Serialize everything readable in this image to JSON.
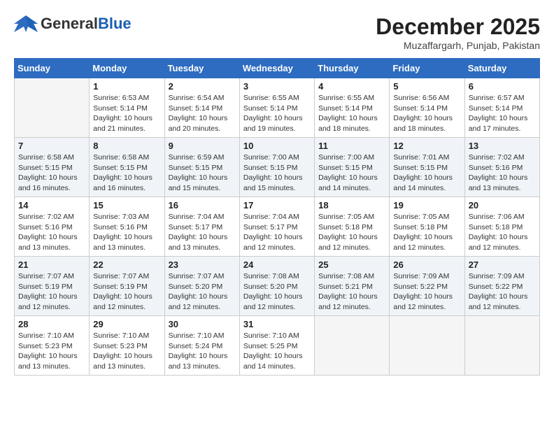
{
  "header": {
    "logo": {
      "general": "General",
      "blue": "Blue"
    },
    "title": "December 2025",
    "location": "Muzaffargarh, Punjab, Pakistan"
  },
  "weekdays": [
    "Sunday",
    "Monday",
    "Tuesday",
    "Wednesday",
    "Thursday",
    "Friday",
    "Saturday"
  ],
  "weeks": [
    {
      "shaded": false,
      "days": [
        {
          "num": "",
          "sunrise": "",
          "sunset": "",
          "daylight": "",
          "empty": true
        },
        {
          "num": "1",
          "sunrise": "Sunrise: 6:53 AM",
          "sunset": "Sunset: 5:14 PM",
          "daylight": "Daylight: 10 hours and 21 minutes.",
          "empty": false
        },
        {
          "num": "2",
          "sunrise": "Sunrise: 6:54 AM",
          "sunset": "Sunset: 5:14 PM",
          "daylight": "Daylight: 10 hours and 20 minutes.",
          "empty": false
        },
        {
          "num": "3",
          "sunrise": "Sunrise: 6:55 AM",
          "sunset": "Sunset: 5:14 PM",
          "daylight": "Daylight: 10 hours and 19 minutes.",
          "empty": false
        },
        {
          "num": "4",
          "sunrise": "Sunrise: 6:55 AM",
          "sunset": "Sunset: 5:14 PM",
          "daylight": "Daylight: 10 hours and 18 minutes.",
          "empty": false
        },
        {
          "num": "5",
          "sunrise": "Sunrise: 6:56 AM",
          "sunset": "Sunset: 5:14 PM",
          "daylight": "Daylight: 10 hours and 18 minutes.",
          "empty": false
        },
        {
          "num": "6",
          "sunrise": "Sunrise: 6:57 AM",
          "sunset": "Sunset: 5:14 PM",
          "daylight": "Daylight: 10 hours and 17 minutes.",
          "empty": false
        }
      ]
    },
    {
      "shaded": true,
      "days": [
        {
          "num": "7",
          "sunrise": "Sunrise: 6:58 AM",
          "sunset": "Sunset: 5:15 PM",
          "daylight": "Daylight: 10 hours and 16 minutes.",
          "empty": false
        },
        {
          "num": "8",
          "sunrise": "Sunrise: 6:58 AM",
          "sunset": "Sunset: 5:15 PM",
          "daylight": "Daylight: 10 hours and 16 minutes.",
          "empty": false
        },
        {
          "num": "9",
          "sunrise": "Sunrise: 6:59 AM",
          "sunset": "Sunset: 5:15 PM",
          "daylight": "Daylight: 10 hours and 15 minutes.",
          "empty": false
        },
        {
          "num": "10",
          "sunrise": "Sunrise: 7:00 AM",
          "sunset": "Sunset: 5:15 PM",
          "daylight": "Daylight: 10 hours and 15 minutes.",
          "empty": false
        },
        {
          "num": "11",
          "sunrise": "Sunrise: 7:00 AM",
          "sunset": "Sunset: 5:15 PM",
          "daylight": "Daylight: 10 hours and 14 minutes.",
          "empty": false
        },
        {
          "num": "12",
          "sunrise": "Sunrise: 7:01 AM",
          "sunset": "Sunset: 5:15 PM",
          "daylight": "Daylight: 10 hours and 14 minutes.",
          "empty": false
        },
        {
          "num": "13",
          "sunrise": "Sunrise: 7:02 AM",
          "sunset": "Sunset: 5:16 PM",
          "daylight": "Daylight: 10 hours and 13 minutes.",
          "empty": false
        }
      ]
    },
    {
      "shaded": false,
      "days": [
        {
          "num": "14",
          "sunrise": "Sunrise: 7:02 AM",
          "sunset": "Sunset: 5:16 PM",
          "daylight": "Daylight: 10 hours and 13 minutes.",
          "empty": false
        },
        {
          "num": "15",
          "sunrise": "Sunrise: 7:03 AM",
          "sunset": "Sunset: 5:16 PM",
          "daylight": "Daylight: 10 hours and 13 minutes.",
          "empty": false
        },
        {
          "num": "16",
          "sunrise": "Sunrise: 7:04 AM",
          "sunset": "Sunset: 5:17 PM",
          "daylight": "Daylight: 10 hours and 13 minutes.",
          "empty": false
        },
        {
          "num": "17",
          "sunrise": "Sunrise: 7:04 AM",
          "sunset": "Sunset: 5:17 PM",
          "daylight": "Daylight: 10 hours and 12 minutes.",
          "empty": false
        },
        {
          "num": "18",
          "sunrise": "Sunrise: 7:05 AM",
          "sunset": "Sunset: 5:18 PM",
          "daylight": "Daylight: 10 hours and 12 minutes.",
          "empty": false
        },
        {
          "num": "19",
          "sunrise": "Sunrise: 7:05 AM",
          "sunset": "Sunset: 5:18 PM",
          "daylight": "Daylight: 10 hours and 12 minutes.",
          "empty": false
        },
        {
          "num": "20",
          "sunrise": "Sunrise: 7:06 AM",
          "sunset": "Sunset: 5:18 PM",
          "daylight": "Daylight: 10 hours and 12 minutes.",
          "empty": false
        }
      ]
    },
    {
      "shaded": true,
      "days": [
        {
          "num": "21",
          "sunrise": "Sunrise: 7:07 AM",
          "sunset": "Sunset: 5:19 PM",
          "daylight": "Daylight: 10 hours and 12 minutes.",
          "empty": false
        },
        {
          "num": "22",
          "sunrise": "Sunrise: 7:07 AM",
          "sunset": "Sunset: 5:19 PM",
          "daylight": "Daylight: 10 hours and 12 minutes.",
          "empty": false
        },
        {
          "num": "23",
          "sunrise": "Sunrise: 7:07 AM",
          "sunset": "Sunset: 5:20 PM",
          "daylight": "Daylight: 10 hours and 12 minutes.",
          "empty": false
        },
        {
          "num": "24",
          "sunrise": "Sunrise: 7:08 AM",
          "sunset": "Sunset: 5:20 PM",
          "daylight": "Daylight: 10 hours and 12 minutes.",
          "empty": false
        },
        {
          "num": "25",
          "sunrise": "Sunrise: 7:08 AM",
          "sunset": "Sunset: 5:21 PM",
          "daylight": "Daylight: 10 hours and 12 minutes.",
          "empty": false
        },
        {
          "num": "26",
          "sunrise": "Sunrise: 7:09 AM",
          "sunset": "Sunset: 5:22 PM",
          "daylight": "Daylight: 10 hours and 12 minutes.",
          "empty": false
        },
        {
          "num": "27",
          "sunrise": "Sunrise: 7:09 AM",
          "sunset": "Sunset: 5:22 PM",
          "daylight": "Daylight: 10 hours and 12 minutes.",
          "empty": false
        }
      ]
    },
    {
      "shaded": false,
      "days": [
        {
          "num": "28",
          "sunrise": "Sunrise: 7:10 AM",
          "sunset": "Sunset: 5:23 PM",
          "daylight": "Daylight: 10 hours and 13 minutes.",
          "empty": false
        },
        {
          "num": "29",
          "sunrise": "Sunrise: 7:10 AM",
          "sunset": "Sunset: 5:23 PM",
          "daylight": "Daylight: 10 hours and 13 minutes.",
          "empty": false
        },
        {
          "num": "30",
          "sunrise": "Sunrise: 7:10 AM",
          "sunset": "Sunset: 5:24 PM",
          "daylight": "Daylight: 10 hours and 13 minutes.",
          "empty": false
        },
        {
          "num": "31",
          "sunrise": "Sunrise: 7:10 AM",
          "sunset": "Sunset: 5:25 PM",
          "daylight": "Daylight: 10 hours and 14 minutes.",
          "empty": false
        },
        {
          "num": "",
          "sunrise": "",
          "sunset": "",
          "daylight": "",
          "empty": true
        },
        {
          "num": "",
          "sunrise": "",
          "sunset": "",
          "daylight": "",
          "empty": true
        },
        {
          "num": "",
          "sunrise": "",
          "sunset": "",
          "daylight": "",
          "empty": true
        }
      ]
    }
  ]
}
